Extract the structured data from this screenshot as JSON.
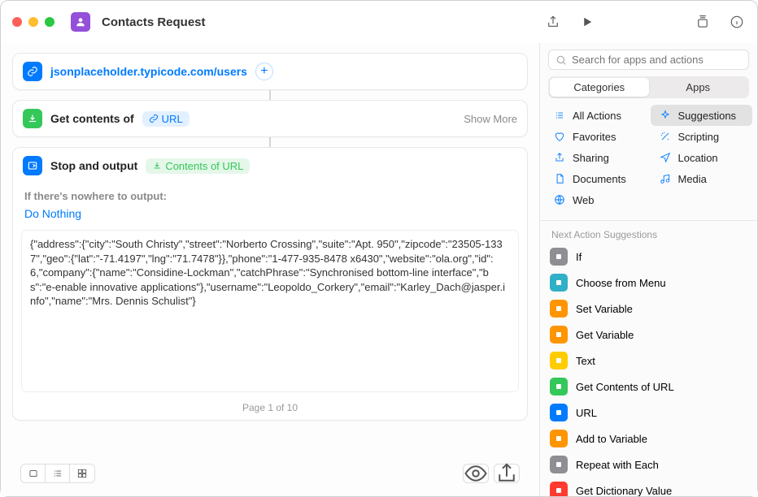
{
  "window": {
    "title": "Contacts Request"
  },
  "url_action": {
    "url": "jsonplaceholder.typicode.com/users"
  },
  "get_contents": {
    "label": "Get contents of",
    "pill": "URL",
    "show_more": "Show More"
  },
  "stop_output": {
    "label": "Stop and output",
    "pill": "Contents of URL",
    "no_output_label": "If there's nowhere to output:",
    "no_output_action": "Do Nothing",
    "output_text": "{\"address\":{\"city\":\"South Christy\",\"street\":\"Norberto Crossing\",\"suite\":\"Apt. 950\",\"zipcode\":\"23505-1337\",\"geo\":{\"lat\":\"-71.4197\",\"lng\":\"71.7478\"}},\"phone\":\"1-477-935-8478 x6430\",\"website\":\"ola.org\",\"id\":6,\"company\":{\"name\":\"Considine-Lockman\",\"catchPhrase\":\"Synchronised bottom-line interface\",\"bs\":\"e-enable innovative applications\"},\"username\":\"Leopoldo_Corkery\",\"email\":\"Karley_Dach@jasper.info\",\"name\":\"Mrs. Dennis Schulist\"}",
    "page_indicator": "Page 1 of 10"
  },
  "sidebar": {
    "search_placeholder": "Search for apps and actions",
    "tabs": {
      "categories": "Categories",
      "apps": "Apps"
    },
    "categories": {
      "all": "All Actions",
      "suggestions": "Suggestions",
      "favorites": "Favorites",
      "scripting": "Scripting",
      "sharing": "Sharing",
      "location": "Location",
      "documents": "Documents",
      "media": "Media",
      "web": "Web"
    },
    "suggestions_header": "Next Action Suggestions",
    "suggestions": [
      {
        "label": "If",
        "color": "c-gray"
      },
      {
        "label": "Choose from Menu",
        "color": "c-teal"
      },
      {
        "label": "Set Variable",
        "color": "c-orange"
      },
      {
        "label": "Get Variable",
        "color": "c-orange"
      },
      {
        "label": "Text",
        "color": "c-yellow"
      },
      {
        "label": "Get Contents of URL",
        "color": "c-green2"
      },
      {
        "label": "URL",
        "color": "c-blue2"
      },
      {
        "label": "Add to Variable",
        "color": "c-orange2"
      },
      {
        "label": "Repeat with Each",
        "color": "c-gray2"
      },
      {
        "label": "Get Dictionary Value",
        "color": "c-red"
      }
    ]
  }
}
